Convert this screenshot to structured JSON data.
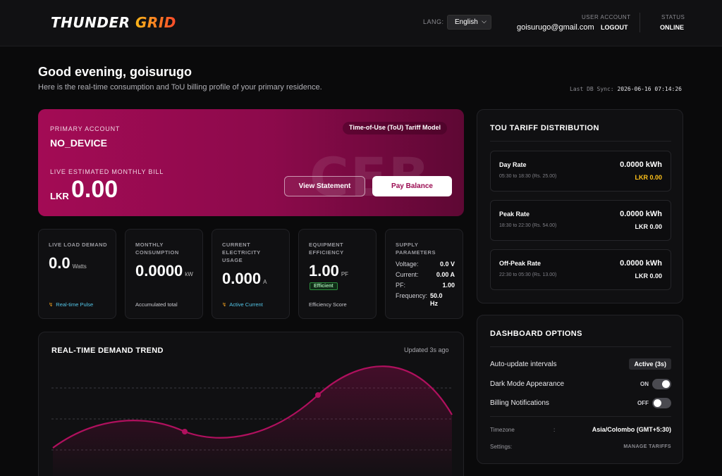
{
  "header": {
    "logo_part1": "THUNDER",
    "logo_part2": "GRID",
    "lang_label": "LANG:",
    "lang_value": "English",
    "user_account_label": "USER ACCOUNT",
    "user_email": "goisurugo@gmail.com",
    "logout_label": "LOGOUT",
    "status_label": "STATUS",
    "status_value": "ONLINE"
  },
  "greeting": {
    "title": "Good evening, goisurugo",
    "subtitle": "Here is the real-time consumption and ToU billing profile of your primary residence.",
    "sync_label": "Last DB Sync:",
    "sync_value": "2026-06-16 07:14:26"
  },
  "account": {
    "label": "PRIMARY ACCOUNT",
    "device": "NO_DEVICE",
    "tariff_badge": "Time-of-Use (ToU) Tariff Model",
    "bill_label": "LIVE ESTIMATED MONTHLY BILL",
    "currency": "LKR",
    "amount": "0.00",
    "watermark": "CEB",
    "view_statement": "View Statement",
    "pay_balance": "Pay Balance"
  },
  "metrics": {
    "load": {
      "label": "LIVE LOAD DEMAND",
      "value": "0.0",
      "unit": "Watts",
      "footer": "Real-time Pulse"
    },
    "consumption": {
      "label": "MONTHLY CONSUMPTION",
      "value": "0.0000",
      "unit": "kW",
      "footer": "Accumulated total"
    },
    "current": {
      "label": "CURRENT ELECTRICITY USAGE",
      "value": "0.000",
      "unit": "A",
      "footer": "Active Current"
    },
    "efficiency": {
      "label": "EQUIPMENT EFFICIENCY",
      "value": "1.00",
      "unit": "PF",
      "badge": "Efficient",
      "footer": "Efficiency Score"
    },
    "supply": {
      "label": "SUPPLY PARAMETERS",
      "voltage_label": "Voltage:",
      "voltage": "0.0 V",
      "current_label": "Current:",
      "current": "0.00 A",
      "pf_label": "PF:",
      "pf": "1.00",
      "frequency_label": "Frequency:",
      "frequency_line1": "50.0",
      "frequency_line2": "Hz"
    }
  },
  "trend": {
    "title": "REAL-TIME DEMAND TREND",
    "updated": "Updated 3s ago"
  },
  "tou": {
    "title": "TOU TARIFF DISTRIBUTION",
    "rates": [
      {
        "name": "Day Rate",
        "time": "05:30 to 18:30 (Rs. 25.00)",
        "kwh": "0.0000 kWh",
        "lkr": "LKR 0.00"
      },
      {
        "name": "Peak Rate",
        "time": "18:30 to 22:30 (Rs. 54.00)",
        "kwh": "0.0000 kWh",
        "lkr": "LKR 0.00"
      },
      {
        "name": "Off-Peak Rate",
        "time": "22:30 to 05:30 (Rs. 13.00)",
        "kwh": "0.0000 kWh",
        "lkr": "LKR 0.00"
      }
    ],
    "colors": {
      "day_lkr": "#ffc21a",
      "other_lkr": "#ffffff"
    }
  },
  "options": {
    "title": "DASHBOARD OPTIONS",
    "auto_update_label": "Auto-update intervals",
    "auto_update_value": "Active (3s)",
    "dark_mode_label": "Dark Mode Appearance",
    "dark_mode_state": "ON",
    "billing_label": "Billing Notifications",
    "billing_state": "OFF",
    "timezone_label": "Timezone",
    "timezone_colon": ":",
    "timezone_value": "Asia/Colombo (GMT+5:30)",
    "settings_label": "Settings:",
    "settings_link": "MANAGE TARIFFS"
  },
  "theme": {
    "accent": "#a30b55",
    "background": "#0a0a0b",
    "card": "#101012"
  }
}
